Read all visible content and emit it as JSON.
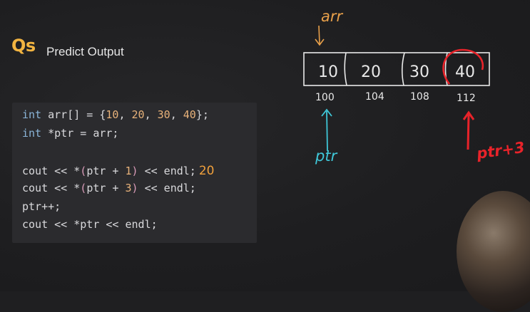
{
  "slide": {
    "badge": "Qs",
    "title": "Predict Output"
  },
  "code": {
    "line1": {
      "kw": "int",
      "a": " arr[] = {",
      "n1": "10",
      "c1": ", ",
      "n2": "20",
      "c2": ", ",
      "n3": "30",
      "c3": ", ",
      "n4": "40",
      "end": "};"
    },
    "line2": {
      "kw": "int",
      "rest": " *ptr = arr;"
    },
    "line3": {
      "a": "cout << *",
      "p1": "(",
      "b": "ptr + ",
      "n": "1",
      "p2": ")",
      "c": " << endl;",
      "note": "20"
    },
    "line4": {
      "a": "cout << *",
      "p1": "(",
      "b": "ptr + ",
      "n": "3",
      "p2": ")",
      "c": " << endl;"
    },
    "line5": {
      "text": "ptr++;"
    },
    "line6": {
      "text": "cout << *ptr << endl;"
    }
  },
  "diagram": {
    "array_label": "arr",
    "cells": [
      "10",
      "20",
      "30",
      "40"
    ],
    "addresses": [
      "100",
      "104",
      "108",
      "112"
    ],
    "pointer_label": "ptr",
    "offset_label": "ptr+3",
    "colors": {
      "arr": "#e8a04a",
      "ptr": "#3fc7d8",
      "offset": "#e8232a",
      "chalk": "#e9e9e9"
    }
  },
  "webcam": {
    "visible": true
  }
}
